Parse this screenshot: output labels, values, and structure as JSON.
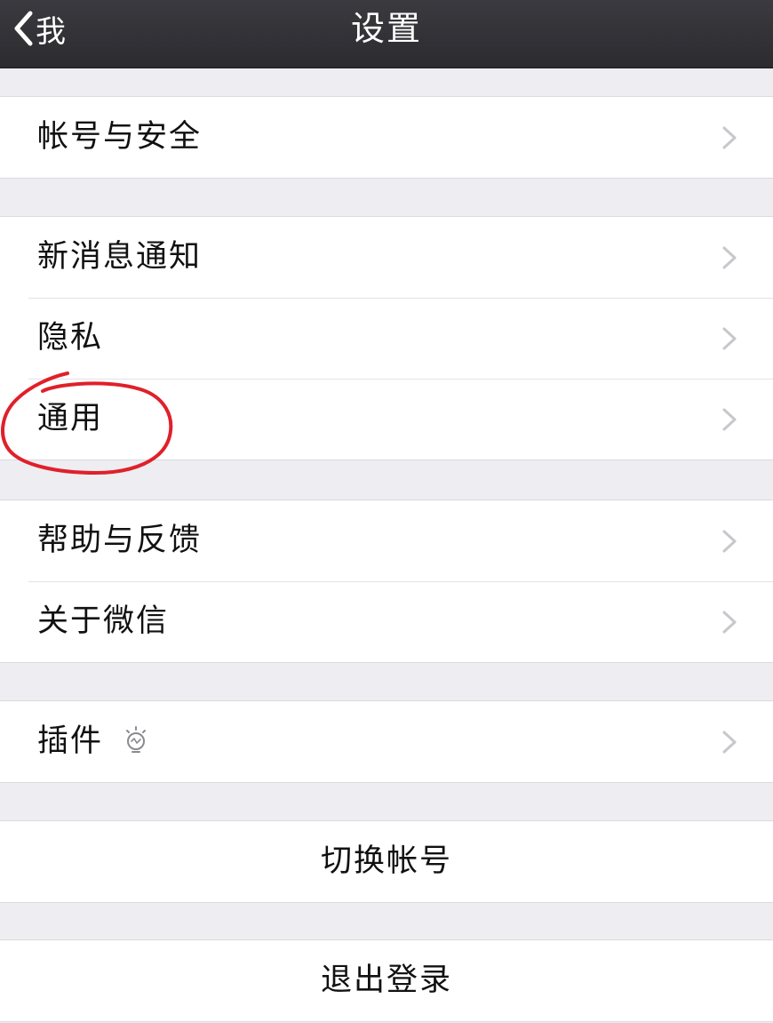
{
  "navbar": {
    "back_label": "我",
    "title": "设置"
  },
  "groups": [
    {
      "items": [
        {
          "label": "帐号与安全"
        }
      ]
    },
    {
      "items": [
        {
          "label": "新消息通知"
        },
        {
          "label": "隐私"
        },
        {
          "label": "通用"
        }
      ]
    },
    {
      "items": [
        {
          "label": "帮助与反馈"
        },
        {
          "label": "关于微信"
        }
      ]
    },
    {
      "items": [
        {
          "label": "插件",
          "icon": "lightbulb-icon"
        }
      ]
    }
  ],
  "actions": {
    "switch_account": "切换帐号",
    "logout": "退出登录"
  },
  "colors": {
    "navbar_bg": "#2b2b30",
    "page_bg": "#eeeef2",
    "annotation_circle": "#e0202a",
    "chevron": "#c7c7cc"
  },
  "annotation": {
    "type": "hand-drawn-circle",
    "target": "通用"
  }
}
